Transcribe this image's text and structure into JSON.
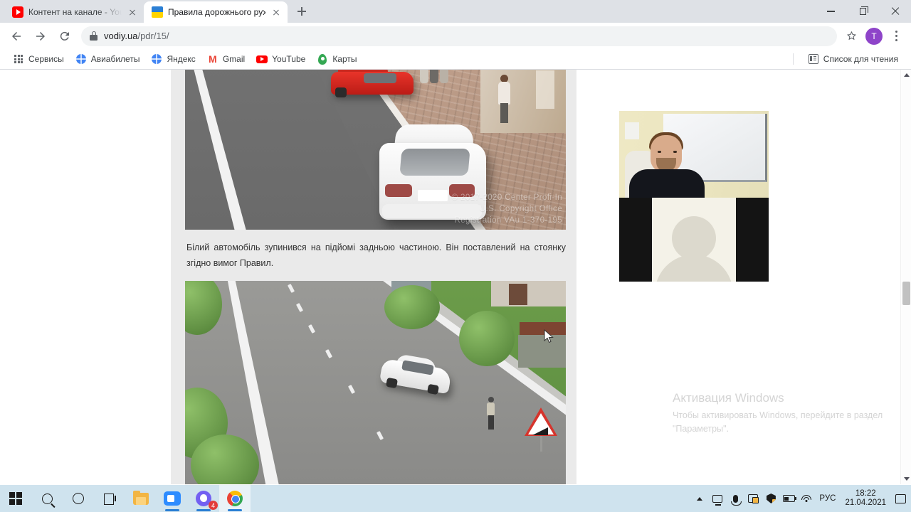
{
  "browser": {
    "tabs": [
      {
        "title": "Контент на канале - YouTube St",
        "favicon": "youtube-icon",
        "active": false
      },
      {
        "title": "Правила дорожнього руху. Зуп",
        "favicon": "ukraine-flag-icon",
        "active": true
      }
    ],
    "new_tab_label": "+",
    "window_controls": {
      "minimize": "minimize",
      "maximize": "restore",
      "close": "close"
    },
    "toolbar": {
      "back": "back-arrow",
      "forward": "forward-arrow",
      "reload": "reload",
      "url_host": "vodiy.ua",
      "url_path": "/pdr/15/",
      "lock": "secure-lock",
      "bookmark_star": "star",
      "profile_initial": "T",
      "menu": "three-dot-menu"
    },
    "bookmarks": [
      {
        "label": "Сервисы",
        "icon": "apps-grid-icon"
      },
      {
        "label": "Авиабилеты",
        "icon": "globe-icon"
      },
      {
        "label": "Яндекс",
        "icon": "globe-icon"
      },
      {
        "label": "Gmail",
        "icon": "gmail-icon"
      },
      {
        "label": "YouTube",
        "icon": "youtube-icon"
      },
      {
        "label": "Карты",
        "icon": "maps-pin-icon"
      }
    ],
    "bookmarks_right": {
      "label": "Список для чтения",
      "icon": "reading-list-icon"
    }
  },
  "page": {
    "caption": "Білий автомобіль зупинився на підйомі задньою частиною. Він поставлений на стоянку згідно вимог Правил.",
    "image1": {
      "name": "white-suv-parked-rear-uphill",
      "watermark_line1": "© 2017-2020 Center Profi-In",
      "watermark_line2": "U.S. Copyright Office",
      "watermark_line3": "Registration VAu 1-370-195"
    },
    "image2": {
      "name": "white-car-parked-roadside-slope-sign"
    }
  },
  "video": {
    "tile_top": "webcam-presenter",
    "tile_bottom": "participant-avatar-placeholder"
  },
  "watermark": {
    "title": "Активация Windows",
    "subtitle": "Чтобы активировать Windows, перейдите в раздел \"Параметры\"."
  },
  "taskbar": {
    "items": [
      {
        "name": "start-button",
        "icon": "windows-logo-icon"
      },
      {
        "name": "search-button",
        "icon": "search-icon"
      },
      {
        "name": "cortana-button",
        "icon": "cortana-circle-icon"
      },
      {
        "name": "task-view-button",
        "icon": "task-view-icon"
      },
      {
        "name": "file-explorer-button",
        "icon": "folder-icon"
      },
      {
        "name": "zoom-app-button",
        "icon": "zoom-camera-icon"
      },
      {
        "name": "viber-app-button",
        "icon": "viber-icon",
        "badge": "4"
      },
      {
        "name": "chrome-app-button",
        "icon": "chrome-icon"
      }
    ],
    "tray": {
      "show_hidden": "chevron-up-icon",
      "camera": "camera-icon",
      "microphone": "microphone-icon",
      "display": "display-icon",
      "security": "shield-icon",
      "battery": "battery-icon",
      "network": "wifi-icon",
      "language": "РУС",
      "time": "18:22",
      "date": "21.04.2021",
      "notifications": "notification-icon"
    }
  },
  "colors": {
    "chrome_tabstrip": "#dee1e6",
    "accent_blue": "#2a7fd4",
    "taskbar": "#cfe3ee",
    "profile_avatar": "#8e44c9"
  }
}
